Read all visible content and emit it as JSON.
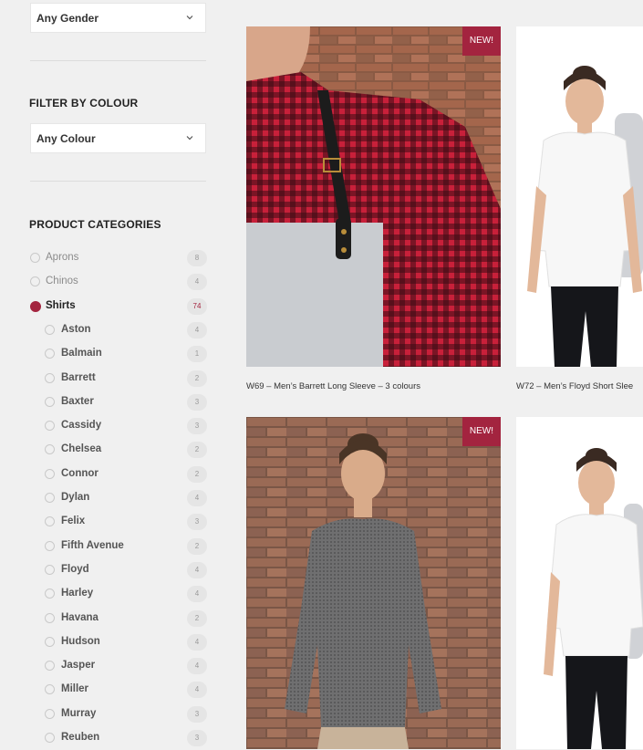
{
  "sidebar": {
    "gender_filter": {
      "value": "Any Gender"
    },
    "colour_filter": {
      "heading": "FILTER BY COLOUR",
      "value": "Any Colour"
    },
    "categories": {
      "heading": "PRODUCT CATEGORIES",
      "items": [
        {
          "label": "Aprons",
          "count": "8"
        },
        {
          "label": "Chinos",
          "count": "4"
        },
        {
          "label": "Shirts",
          "count": "74",
          "selected": true
        },
        {
          "label": "Aston",
          "count": "4",
          "sub": true
        },
        {
          "label": "Balmain",
          "count": "1",
          "sub": true
        },
        {
          "label": "Barrett",
          "count": "2",
          "sub": true
        },
        {
          "label": "Baxter",
          "count": "3",
          "sub": true
        },
        {
          "label": "Cassidy",
          "count": "3",
          "sub": true
        },
        {
          "label": "Chelsea",
          "count": "2",
          "sub": true
        },
        {
          "label": "Connor",
          "count": "2",
          "sub": true
        },
        {
          "label": "Dylan",
          "count": "4",
          "sub": true
        },
        {
          "label": "Felix",
          "count": "3",
          "sub": true
        },
        {
          "label": "Fifth Avenue",
          "count": "2",
          "sub": true
        },
        {
          "label": "Floyd",
          "count": "4",
          "sub": true
        },
        {
          "label": "Harley",
          "count": "4",
          "sub": true
        },
        {
          "label": "Havana",
          "count": "2",
          "sub": true
        },
        {
          "label": "Hudson",
          "count": "4",
          "sub": true
        },
        {
          "label": "Jasper",
          "count": "4",
          "sub": true
        },
        {
          "label": "Miller",
          "count": "4",
          "sub": true
        },
        {
          "label": "Murray",
          "count": "3",
          "sub": true
        },
        {
          "label": "Reuben",
          "count": "3",
          "sub": true
        }
      ]
    }
  },
  "products": [
    {
      "title": "W69 – Men’s Barrett Long Sleeve – 3 colours",
      "badge": "NEW!"
    },
    {
      "title": "W72 – Men’s Floyd Short Slee"
    },
    {
      "title": "",
      "badge": "NEW!"
    },
    {
      "title": ""
    }
  ],
  "colors": {
    "accent": "#a3243f"
  }
}
